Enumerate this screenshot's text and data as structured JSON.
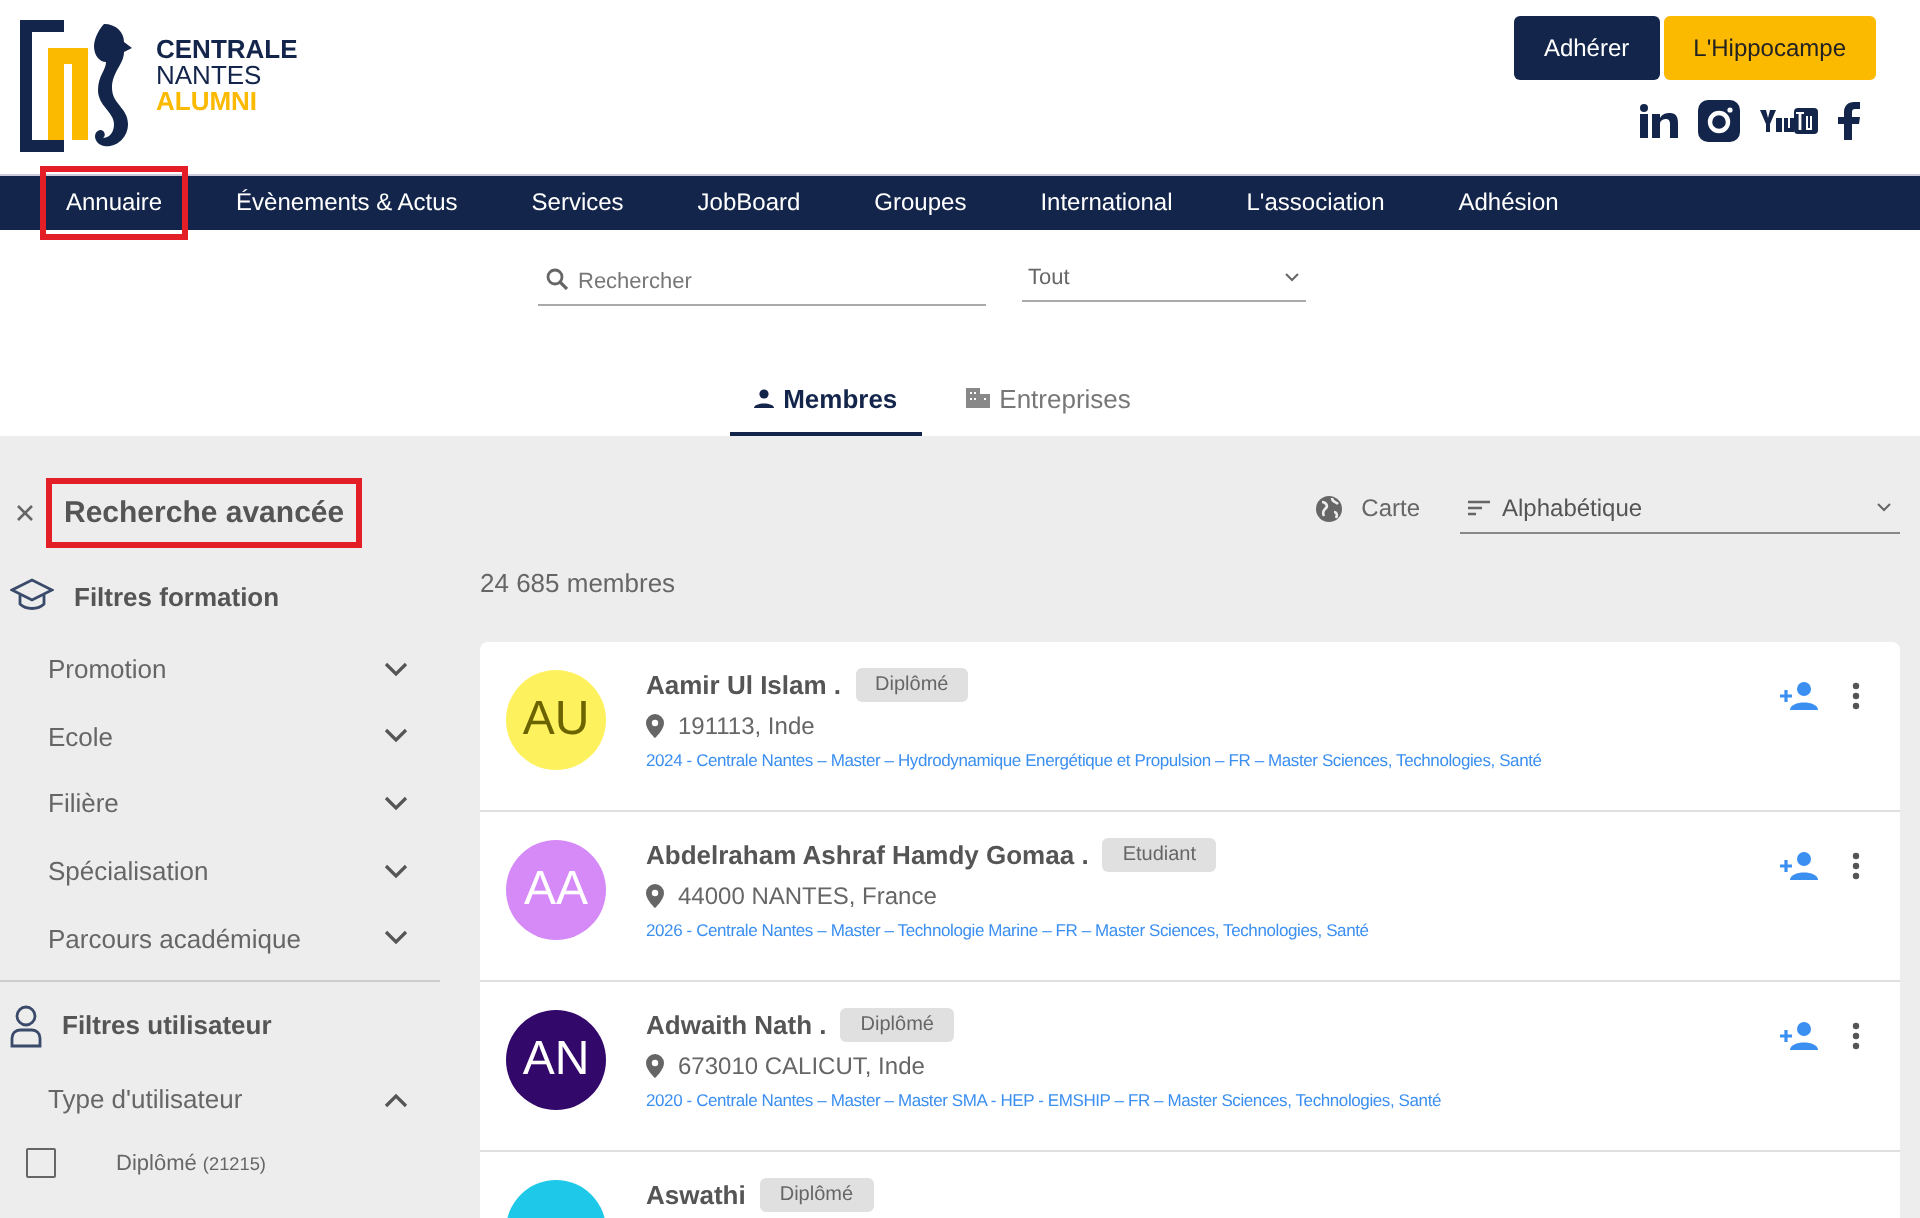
{
  "logo": {
    "line_1": "CENTRALE",
    "line_2": "NANTES",
    "line_3": "ALUMNI"
  },
  "header_buttons": [
    {
      "label": "Adhérer",
      "kind": "primary"
    },
    {
      "label": "L'Hippocampe",
      "kind": "accent"
    }
  ],
  "nav": [
    {
      "label": "Annuaire",
      "highlighted": true
    },
    {
      "label": "Évènements & Actus",
      "highlighted": false
    },
    {
      "label": "Services",
      "highlighted": false
    },
    {
      "label": "JobBoard",
      "highlighted": false
    },
    {
      "label": "Groupes",
      "highlighted": false
    },
    {
      "label": "International",
      "highlighted": false
    },
    {
      "label": "L'association",
      "highlighted": false
    },
    {
      "label": "Adhésion",
      "highlighted": false
    }
  ],
  "search": {
    "placeholder": "Rechercher",
    "scope": "Tout"
  },
  "tabs": [
    {
      "label": "Membres",
      "selected": true,
      "kind": "person"
    },
    {
      "label": "Entreprises",
      "selected": false,
      "kind": "building"
    }
  ],
  "advanced_search": {
    "title": "Recherche avancée",
    "highlighted": true
  },
  "map_link": "Carte",
  "sort": "Alphabétique",
  "count": "24 685 membres",
  "filter_groups": [
    {
      "title": "Filtres formation",
      "kind": "education",
      "items": [
        {
          "label": "Promotion",
          "expanded": false
        },
        {
          "label": "Ecole",
          "expanded": false
        },
        {
          "label": "Filière",
          "expanded": false
        },
        {
          "label": "Spécialisation",
          "expanded": false
        },
        {
          "label": "Parcours académique",
          "expanded": false
        }
      ]
    },
    {
      "title": "Filtres utilisateur",
      "kind": "user",
      "items": [
        {
          "label": "Type d'utilisateur",
          "expanded": true,
          "options": [
            {
              "label": "Diplômé",
              "count": "(21215)",
              "checked": false
            }
          ]
        }
      ]
    }
  ],
  "members": [
    {
      "initials": "AU",
      "color": "#fdf25e",
      "name": "Aamir Ul Islam .",
      "status": "Diplômé",
      "location": "191113, Inde",
      "education": "2024 - Centrale Nantes – Master – Hydrodynamique Energétique et Propulsion – FR – Master Sciences, Technologies, Santé"
    },
    {
      "initials": "AA",
      "color": "#d58af7",
      "name": "Abdelraham Ashraf Hamdy Gomaa .",
      "status": "Etudiant",
      "location": "44000 NANTES, France",
      "education": "2026 - Centrale Nantes – Master – Technologie Marine – FR – Master Sciences, Technologies, Santé"
    },
    {
      "initials": "AN",
      "color": "#32086a",
      "name": "Adwaith Nath .",
      "status": "Diplômé",
      "location": "673010 CALICUT, Inde",
      "education": "2020 - Centrale Nantes – Master – Master SMA - HEP - EMSHIP – FR – Master Sciences, Technologies, Santé"
    },
    {
      "color": "#1ec8e8",
      "name": "Aswathi",
      "status": "Diplômé"
    }
  ]
}
